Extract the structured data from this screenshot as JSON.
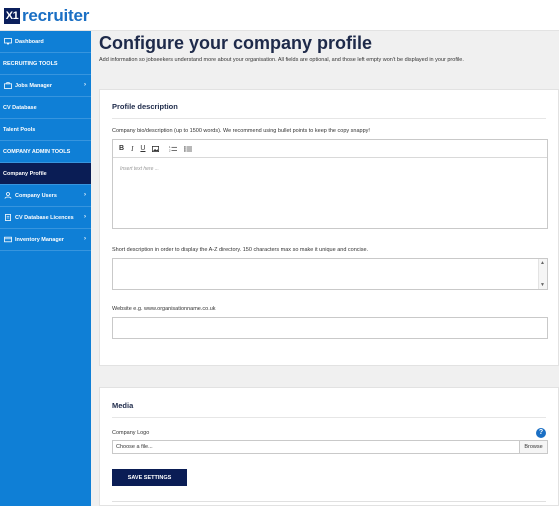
{
  "brand": {
    "logo_mark": "X1",
    "logo_text": "recruiter",
    "accent": "#0f7fd6",
    "dark": "#0a1d55"
  },
  "sidebar": {
    "items": [
      {
        "label": "Dashboard",
        "icon": "monitor-icon",
        "type": "item"
      },
      {
        "label": "RECRUITING TOOLS",
        "type": "section"
      },
      {
        "label": "Jobs Manager",
        "icon": "briefcase-icon",
        "type": "item",
        "chevron": "›"
      },
      {
        "label": "CV Database",
        "type": "item"
      },
      {
        "label": "Talent Pools",
        "type": "item"
      },
      {
        "label": "COMPANY ADMIN TOOLS",
        "type": "section"
      },
      {
        "label": "Company Profile",
        "type": "item",
        "active": true
      },
      {
        "label": "Company Users",
        "icon": "user-icon",
        "type": "item",
        "chevron": "›"
      },
      {
        "label": "CV Database Licences",
        "icon": "document-icon",
        "type": "item",
        "chevron": "›"
      },
      {
        "label": "Inventory Manager",
        "icon": "card-icon",
        "type": "item",
        "chevron": "›"
      }
    ]
  },
  "page": {
    "title": "Configure your company profile",
    "subtitle": "Add information so jobseekers understand more about your organisation. All fields are optional, and those left empty won't be displayed in your profile."
  },
  "profile": {
    "heading": "Profile description",
    "bio_label": "Company bio/description (up to 1500 words). We recommend using bullet points to keep the copy snappy!",
    "toolbar": {
      "bold": "B",
      "italic": "I",
      "underline": "U"
    },
    "bio_placeholder": "Insert text here ...",
    "short_label": "Short description in order to display the A-Z directory. 150 characters max so make it unique and concise.",
    "scroll_up": "▲",
    "scroll_down": "▼",
    "website_label": "Website e.g. www.organisationname.co.uk"
  },
  "media": {
    "heading": "Media",
    "logo_label": "Company Logo",
    "help": "?",
    "file_placeholder": "Choose a file...",
    "browse_label": "Browse",
    "save_label": "SAVE SETTINGS"
  }
}
